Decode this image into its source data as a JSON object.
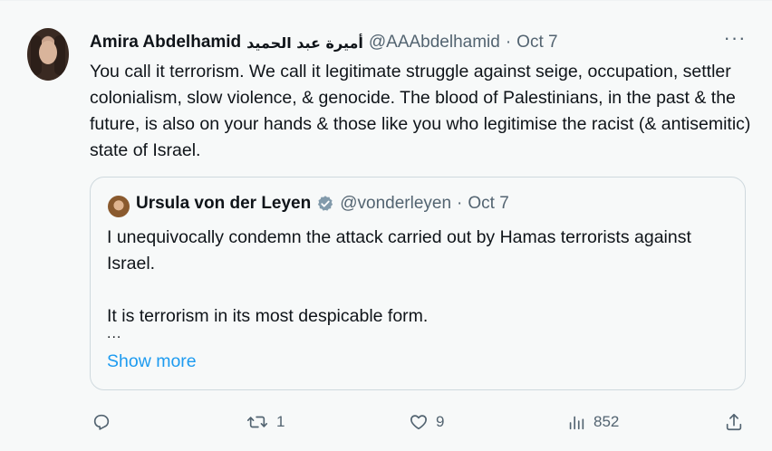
{
  "tweet": {
    "author_name": "Amira Abdelhamid",
    "author_name_arabic": "أميرة عبد الحميد",
    "handle": "@AAAbdelhamid",
    "separator": "·",
    "date": "Oct 7",
    "more_label": "···",
    "text": "You call it terrorism. We call it legitimate struggle against seige, occupation, settler colonialism, slow violence, & genocide. The blood of Palestinians, in the past & the future, is also on your hands & those like you who legitimise the racist (& antisemitic) state of Israel."
  },
  "quoted": {
    "author_name": "Ursula von der Leyen",
    "verified": true,
    "handle": "@vonderleyen",
    "separator": "·",
    "date": "Oct 7",
    "line1": "I unequivocally condemn the attack carried out by Hamas terrorists against Israel.",
    "line2": "It is terrorism in its most despicable form.",
    "ellipsis": "...",
    "show_more": "Show more"
  },
  "actions": {
    "replies": "",
    "retweets": "1",
    "likes": "9",
    "views": "852"
  },
  "icons": {
    "reply": "reply-icon",
    "retweet": "retweet-icon",
    "like": "heart-icon",
    "views": "views-icon",
    "share": "share-icon",
    "verified": "verified-badge-icon"
  },
  "colors": {
    "link": "#1d9bf0",
    "muted": "#536471",
    "verified_badge": "#829aab"
  }
}
